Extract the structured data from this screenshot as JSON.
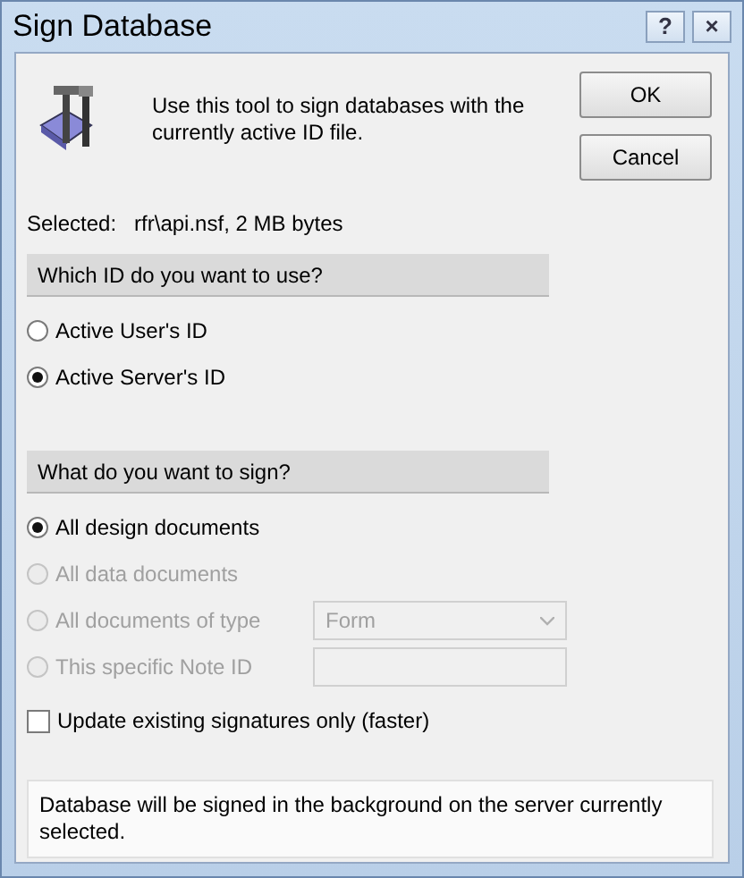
{
  "window": {
    "title": "Sign Database",
    "title_buttons": [
      "?",
      "×"
    ]
  },
  "description": "Use this tool to sign databases with the currently active ID file.",
  "buttons": [
    "OK",
    "Cancel"
  ],
  "selected": {
    "label": "Selected:",
    "value": "rfr\\api.nsf, 2 MB bytes"
  },
  "id_section": {
    "heading": "Which ID do you want to use?",
    "options": [
      {
        "label": "Active User's ID",
        "selected": false,
        "disabled": false
      },
      {
        "label": "Active Server's ID",
        "selected": true,
        "disabled": false
      }
    ]
  },
  "sign_section": {
    "heading": "What do you want to sign?",
    "options": [
      {
        "kind": "plain",
        "label": "All design documents",
        "selected": true,
        "disabled": false
      },
      {
        "kind": "plain",
        "label": "All data documents",
        "selected": false,
        "disabled": true
      },
      {
        "kind": "dropdown",
        "label": "All documents of type",
        "selected": false,
        "disabled": true,
        "value": "Form"
      },
      {
        "kind": "field",
        "label": "This specific Note ID",
        "selected": false,
        "disabled": true
      }
    ]
  },
  "checkbox": {
    "label": "Update existing signatures only (faster)",
    "checked": false
  },
  "info": "Database will be signed in the background on the server currently selected."
}
